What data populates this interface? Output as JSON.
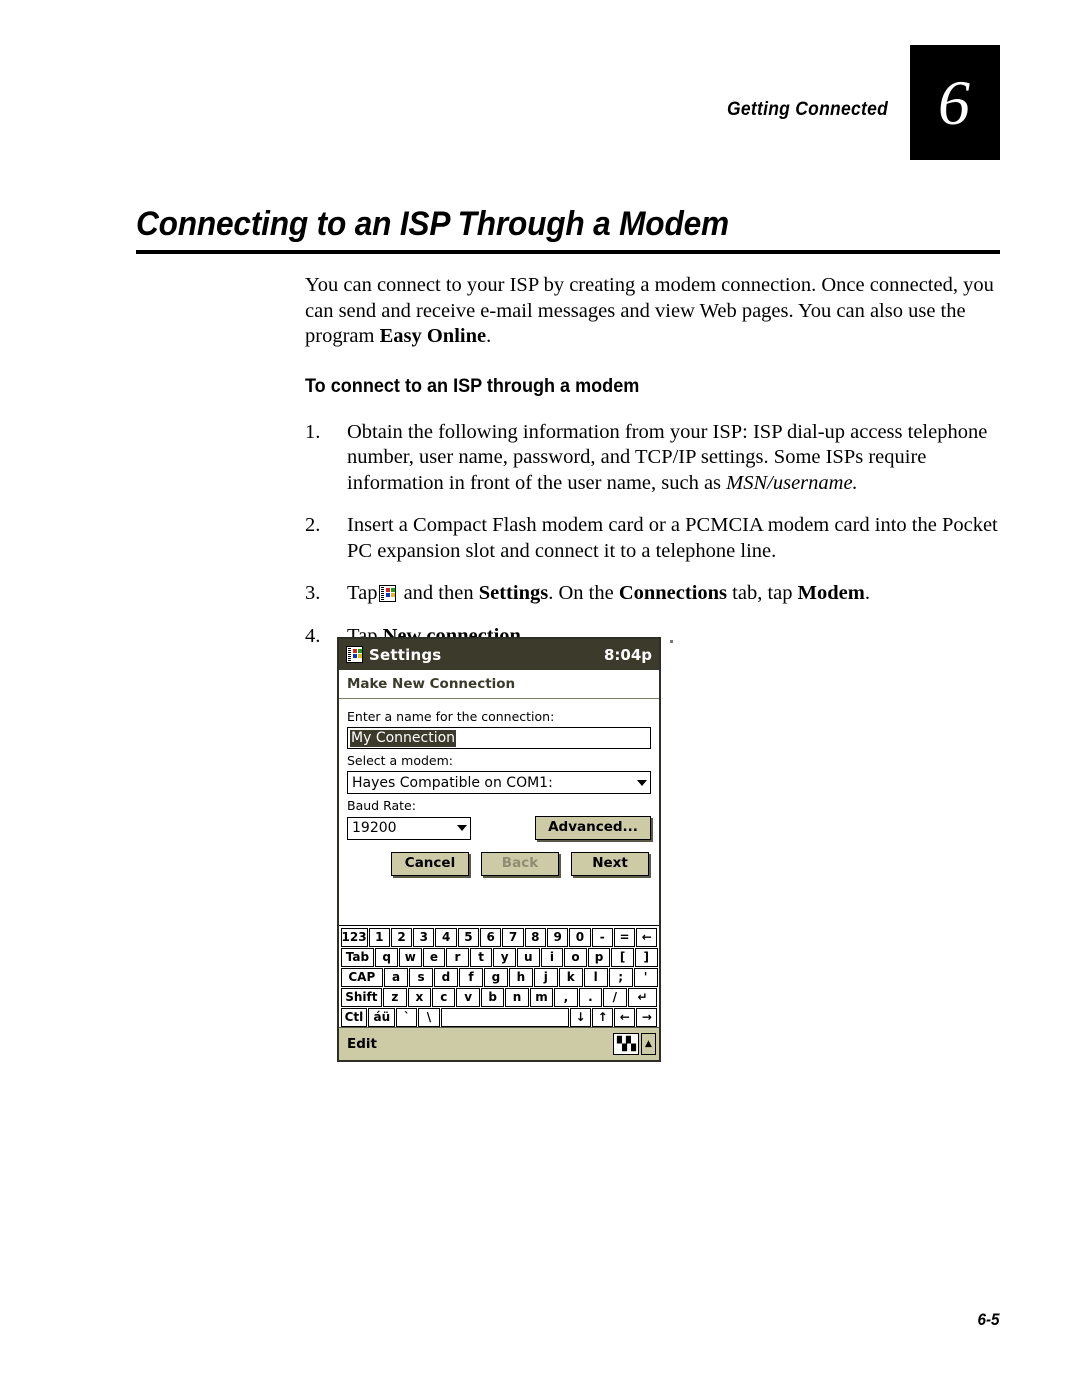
{
  "header": {
    "chapter_label": "Getting Connected",
    "chapter_number": "6"
  },
  "title": "Connecting to an ISP Through a Modem",
  "intro": {
    "part1": "You can connect to your ISP by creating a modem connection. Once connected, you can send and receive e-mail messages and view Web pages. You can also use the program ",
    "bold": "Easy Online",
    "part2": "."
  },
  "subheading": "To connect to an ISP through a modem",
  "steps": [
    {
      "num": "1.",
      "text_a": "Obtain the following information from your ISP: ISP dial-up access telephone number, user name, password, and TCP/IP settings. Some ISPs require information in front of the user name, such as ",
      "italic": "MSN/username.",
      "text_b": ""
    },
    {
      "num": "2.",
      "text_a": "Insert a Compact Flash modem card or a PCMCIA modem card into the Pocket PC expansion slot and connect it to a telephone line.",
      "italic": "",
      "text_b": ""
    },
    {
      "num": "3.",
      "tap": "Tap",
      "after_icon": " and then ",
      "bold1": "Settings",
      "mid1": ". On the ",
      "bold2": "Connections",
      "mid2": " tab, tap ",
      "bold3": "Modem",
      "end": "."
    },
    {
      "num": "4.",
      "tap": "Tap ",
      "bold1": "New connection",
      "end": "."
    }
  ],
  "pda": {
    "titlebar": {
      "title": "Settings",
      "clock": "8:04p"
    },
    "page_header": "Make New Connection",
    "fields": {
      "name_label": "Enter a name for the connection:",
      "name_value": "My Connection",
      "modem_label": "Select a modem:",
      "modem_value": "Hayes Compatible on COM1:",
      "baud_label": "Baud Rate:",
      "baud_value": "19200"
    },
    "buttons": {
      "advanced": "Advanced...",
      "cancel": "Cancel",
      "back": "Back",
      "next": "Next"
    },
    "keyboard": {
      "row1": [
        "123",
        "1",
        "2",
        "3",
        "4",
        "5",
        "6",
        "7",
        "8",
        "9",
        "0",
        "-",
        "=",
        "←"
      ],
      "row2": [
        "Tab",
        "q",
        "w",
        "e",
        "r",
        "t",
        "y",
        "u",
        "i",
        "o",
        "p",
        "[",
        "]"
      ],
      "row3": [
        "CAP",
        "a",
        "s",
        "d",
        "f",
        "g",
        "h",
        "j",
        "k",
        "l",
        ";",
        "'"
      ],
      "row4": [
        "Shift",
        "z",
        "x",
        "c",
        "v",
        "b",
        "n",
        "m",
        ",",
        ".",
        "/",
        "↵"
      ],
      "row5": [
        "Ctl",
        "áü",
        "`",
        "\\",
        "",
        "↓",
        "↑",
        "←",
        "→"
      ]
    },
    "softbar": {
      "label": "Edit",
      "keyboard_icon": "keyboard-icon",
      "up_arrow": "▲"
    },
    "colors": {
      "titlebar_bg": "#3b3a2b",
      "button_bg": "#cdcba6",
      "selection_bg": "#3b3a2b",
      "disabled_text": "#8e8d74"
    }
  },
  "page_number": "6-5"
}
